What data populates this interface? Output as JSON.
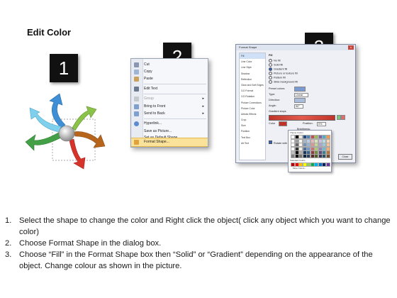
{
  "title": "Edit Color",
  "steps": [
    "1",
    "2",
    "3"
  ],
  "context_menu": {
    "items": [
      {
        "label": "Cut",
        "state": "normal"
      },
      {
        "label": "Copy",
        "state": "normal"
      },
      {
        "label": "Paste",
        "state": "normal"
      },
      {
        "label": "Edit Text",
        "state": "normal"
      },
      {
        "label": "Group",
        "state": "disabled",
        "submenu": true
      },
      {
        "label": "Bring to Front",
        "state": "normal",
        "submenu": true
      },
      {
        "label": "Send to Back",
        "state": "normal",
        "submenu": true
      },
      {
        "label": "Hyperlink...",
        "state": "normal"
      },
      {
        "label": "Save as Picture...",
        "state": "normal"
      },
      {
        "label": "Set as Default Shape",
        "state": "normal"
      },
      {
        "label": "Size and Position...",
        "state": "normal"
      },
      {
        "label": "Format Shape...",
        "state": "highlight"
      }
    ]
  },
  "dialog": {
    "title": "Format Shape",
    "close_glyph": "x",
    "categories": [
      "Fill",
      "Line Color",
      "Line Style",
      "Shadow",
      "Reflection",
      "Glow and Soft Edges",
      "3-D Format",
      "3-D Rotation",
      "Picture Corrections",
      "Picture Color",
      "Artistic Effects",
      "Crop",
      "Size",
      "Position",
      "Text Box",
      "Alt Text"
    ],
    "fill_heading": "Fill",
    "fill_options": [
      "No fill",
      "Solid fill",
      "Gradient fill",
      "Picture or texture fill",
      "Pattern fill",
      "Slide background fill"
    ],
    "selected_option": "Gradient fill",
    "fields": {
      "preset_colors": "Preset colors:",
      "type": "Type:",
      "type_value": "Linear",
      "direction": "Direction:",
      "angle": "Angle:",
      "angle_value": "90°",
      "gradient_stops": "Gradient stops",
      "color": "Color",
      "position": "Position:",
      "position_value": "0%",
      "brightness": "Brightness:",
      "transparency": "Transparency:",
      "rotate": "Rotate with shape"
    },
    "close_label": "Close"
  },
  "palette": {
    "theme_label": "Theme Colors",
    "standard_label": "Standard Colors",
    "more_label": "More Colors...",
    "theme_top": [
      "#ffffff",
      "#000000",
      "#eeece1",
      "#1f497d",
      "#4f81bd",
      "#c0504d",
      "#9bbb59",
      "#8064a2",
      "#4bacc6",
      "#f79646"
    ],
    "standard": [
      "#c00000",
      "#ff0000",
      "#ffc000",
      "#ffff00",
      "#92d050",
      "#00b050",
      "#00b0f0",
      "#0070c0",
      "#002060",
      "#7030a0"
    ]
  },
  "instructions": [
    {
      "num": "1.",
      "text": "Select the shape to change the color and Right click the object( click any object which you want to change color)"
    },
    {
      "num": "2.",
      "text": "Choose Format Shape in the dialog box."
    },
    {
      "num": "3.",
      "text": "Choose “Fill” in the Format Shape box then “Solid” or “Gradient” depending on the appearance of the object. Change colour as shown in the picture."
    }
  ]
}
